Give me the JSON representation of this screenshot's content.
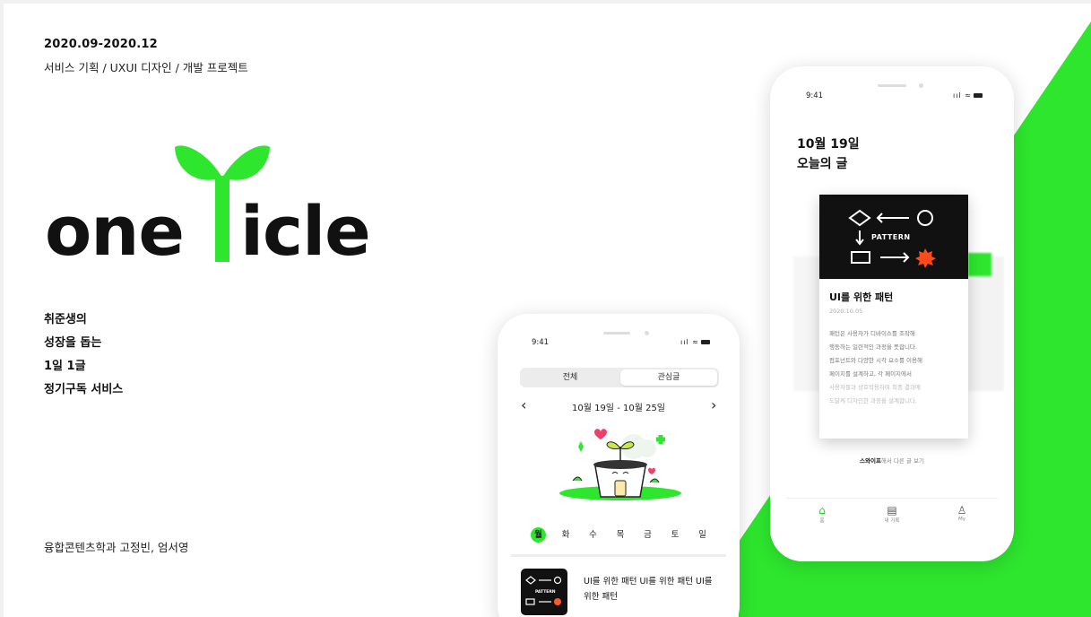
{
  "project": {
    "period": "2020.09-2020.12",
    "roles": "서비스 기획 / UXUI 디자인 / 개발 프로젝트",
    "logo_left": "one",
    "logo_right": "icle",
    "tagline": [
      "취준생의",
      "성장을 돕는",
      "1일 1글",
      "정기구독 서비스"
    ],
    "team": "융합콘텐츠학과 고정빈, 엄서영"
  },
  "colors": {
    "brand_green": "#2ee62e",
    "dark": "#111111"
  },
  "phone_left": {
    "time": "9:41",
    "segments": [
      "전체",
      "관심글"
    ],
    "week_range": "10월 19일 - 10월 25일",
    "prev_icon": "chevron-left-icon",
    "next_icon": "chevron-right-icon",
    "days": [
      "월",
      "화",
      "수",
      "목",
      "금",
      "토",
      "일"
    ],
    "active_day": "월",
    "article": {
      "title": "UI를 위한 패턴 UI를 위한 패턴 UI를 위한 패턴",
      "thumb_label": "PATTERN"
    }
  },
  "phone_right": {
    "time": "9:41",
    "date_line": "10월 19일",
    "heading": "오늘의 글",
    "card": {
      "image_label": "PATTERN",
      "title": "UI를 위한 패턴",
      "date": "2020.10.05",
      "body": [
        "패턴은 사용자가 디바이스를 조작해",
        "행동하는 일련적인 과정을 뜻합니다.",
        "컴포넌트와 다양한 시각 요소를 이용해",
        "페이지를 설계하고, 각 페이지에서",
        "사용자들과 상호작용하며 최종 결과에",
        "도달케 디자인한 과정을 설계합니다."
      ]
    },
    "swipe_bold": "스와이프",
    "swipe_rest": "해서 다른 글 보기",
    "tabs": [
      {
        "label": "홈",
        "icon": "home-icon"
      },
      {
        "label": "내 기록",
        "icon": "document-icon"
      },
      {
        "label": "My",
        "icon": "user-icon"
      }
    ]
  }
}
